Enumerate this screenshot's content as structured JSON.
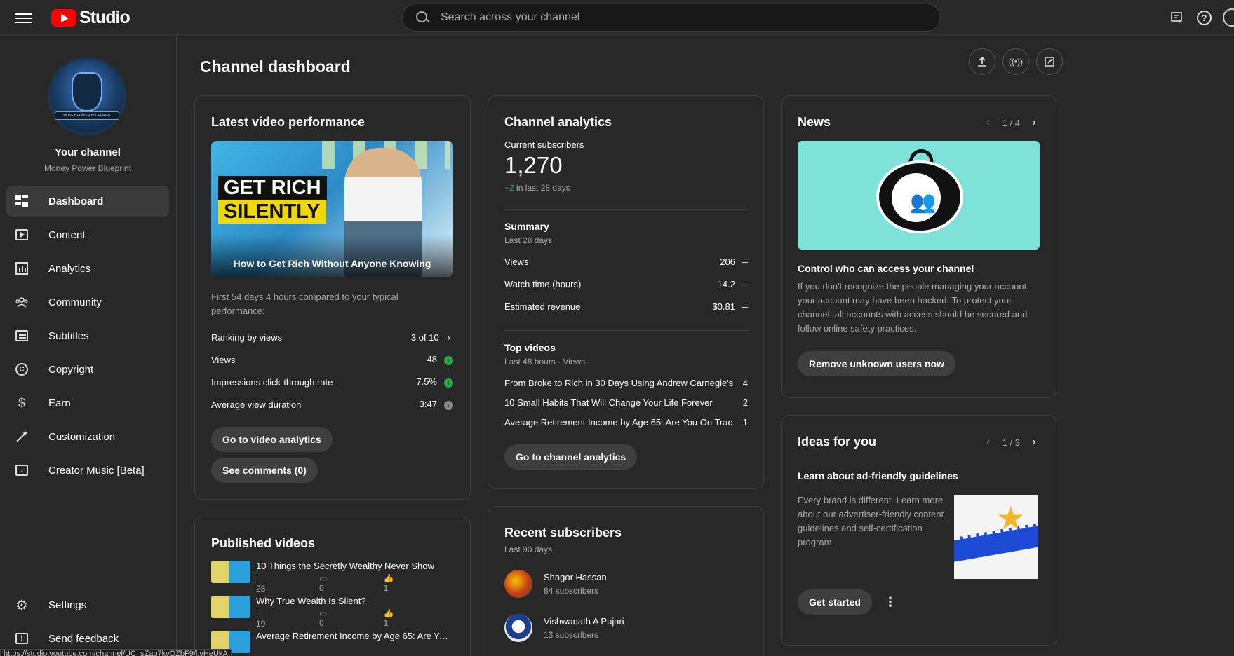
{
  "header": {
    "app_name": "Studio",
    "search_placeholder": "Search across your channel"
  },
  "sidebar": {
    "your_channel": "Your channel",
    "channel_name": "Money Power Blueprint",
    "avatar_banner_text": "MONEY POWER BLUEPRINT",
    "items": [
      {
        "label": "Dashboard",
        "icon": "dashboard-icon",
        "active": true
      },
      {
        "label": "Content",
        "icon": "content-icon"
      },
      {
        "label": "Analytics",
        "icon": "analytics-icon"
      },
      {
        "label": "Community",
        "icon": "community-icon"
      },
      {
        "label": "Subtitles",
        "icon": "subtitles-icon"
      },
      {
        "label": "Copyright",
        "icon": "copyright-icon"
      },
      {
        "label": "Earn",
        "icon": "dollar-icon"
      },
      {
        "label": "Customization",
        "icon": "magic-wand-icon"
      },
      {
        "label": "Creator Music [Beta]",
        "icon": "music-icon"
      }
    ],
    "bottom_items": [
      {
        "label": "Settings",
        "icon": "gear-icon"
      },
      {
        "label": "Send feedback",
        "icon": "feedback-icon"
      }
    ]
  },
  "main": {
    "title": "Channel dashboard",
    "latest": {
      "title": "Latest video performance",
      "thumb_line1": "GET RICH",
      "thumb_line2": "SILENTLY",
      "video_title": "How to Get Rich Without Anyone Knowing",
      "compare_text": "First 54 days 4 hours compared to your typical performance:",
      "rows": [
        {
          "label": "Ranking by views",
          "value": "3 of 10"
        },
        {
          "label": "Views",
          "value": "48"
        },
        {
          "label": "Impressions click-through rate",
          "value": "7.5%"
        },
        {
          "label": "Average view duration",
          "value": "3:47"
        }
      ],
      "btn_analytics": "Go to video analytics",
      "btn_comments": "See comments (0)"
    },
    "analytics": {
      "title": "Channel analytics",
      "subs_label": "Current subscribers",
      "subs_value": "1,270",
      "subs_change": "+2",
      "subs_change_suffix": "in last 28 days",
      "summary_title": "Summary",
      "summary_period": "Last 28 days",
      "summary_rows": [
        {
          "label": "Views",
          "value": "206"
        },
        {
          "label": "Watch time (hours)",
          "value": "14.2"
        },
        {
          "label": "Estimated revenue",
          "value": "$0.81"
        }
      ],
      "top_title": "Top videos",
      "top_period": "Last 48 hours · Views",
      "top_rows": [
        {
          "label": "From Broke to Rich in 30 Days Using Andrew Carnegie's...",
          "value": "4"
        },
        {
          "label": "10 Small Habits That Will Change Your Life Forever",
          "value": "2"
        },
        {
          "label": "Average Retirement Income by Age 65: Are You On Trac...",
          "value": "1"
        }
      ],
      "btn": "Go to channel analytics"
    },
    "news": {
      "title": "News",
      "page": "1 / 4",
      "headline": "Control who can access your channel",
      "body": "If you don't recognize the people managing your account, your account may have been hacked. To protect your channel, all accounts with access should be secured and follow online safety practices.",
      "btn": "Remove unknown users now"
    },
    "ideas": {
      "title": "Ideas for you",
      "page": "1 / 3",
      "headline": "Learn about ad-friendly guidelines",
      "body": "Every brand is different. Learn more about our advertiser-friendly content guidelines and self-certification program",
      "btn": "Get started"
    },
    "published": {
      "title": "Published videos",
      "items": [
        {
          "title": "10 Things the Secretly Wealthy Never Show",
          "views": "28",
          "comments": "0",
          "likes": "1"
        },
        {
          "title": "Why True Wealth Is Silent?",
          "views": "19",
          "comments": "0",
          "likes": "1"
        },
        {
          "title": "Average Retirement Income by Age 65: Are You...",
          "views": "",
          "comments": "",
          "likes": ""
        }
      ]
    },
    "recent_subs": {
      "title": "Recent subscribers",
      "period": "Last 90 days",
      "items": [
        {
          "name": "Shagor Hassan",
          "count": "84 subscribers"
        },
        {
          "name": "Vishwanath A Pujari",
          "count": "13 subscribers"
        }
      ]
    }
  },
  "statusbar": "https://studio.youtube.com/channel/UC_sZap7kvQZbF9/l.vHeUkA"
}
